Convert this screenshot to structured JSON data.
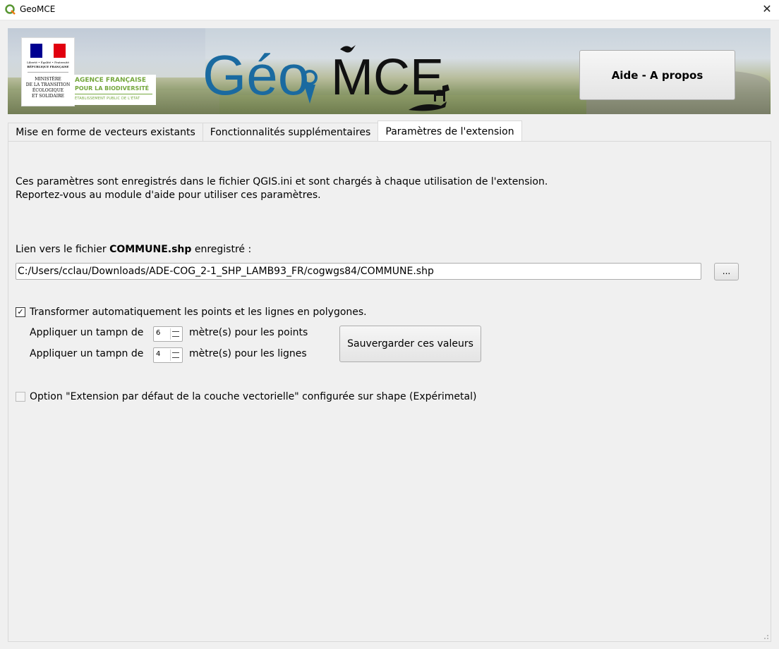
{
  "window": {
    "title": "GeoMCE",
    "close_glyph": "✕"
  },
  "banner": {
    "gov": {
      "motto": "Liberté • Égalité • Fraternité",
      "republic": "RÉPUBLIQUE FRANÇAISE",
      "ministry": [
        "MINISTÈRE",
        "DE LA TRANSITION",
        "ÉCOLOGIQUE",
        "ET SOLIDAIRE"
      ]
    },
    "afb": {
      "line1": "AGENCE FRANÇAISE",
      "line2": "POUR LA BIODIVERSITÉ",
      "line3": "ÉTABLISSEMENT PUBLIC DE L'ÉTAT"
    },
    "logo": {
      "part1": "Géo",
      "part2": "MCE"
    },
    "help_button": "Aide - A propos"
  },
  "tabs": [
    {
      "label": "Mise en forme de vecteurs existants",
      "active": false
    },
    {
      "label": "Fonctionnalités supplémentaires",
      "active": false
    },
    {
      "label": "Paramètres de l'extension",
      "active": true
    }
  ],
  "settings": {
    "description_line1": "Ces paramètres sont enregistrés dans le fichier QGIS.ini et sont chargés à chaque utilisation de l'extension.",
    "description_line2": "Reportez-vous au module d'aide pour utiliser ces paramètres.",
    "file_label_prefix": "Lien vers le fichier",
    "file_label_bold": "COMMUNE.shp",
    "file_label_suffix": "enregistré :",
    "file_path": "C:/Users/cclau/Downloads/ADE-COG_2-1_SHP_LAMB93_FR/cogwgs84/COMMUNE.shp",
    "browse_button": "...",
    "transform_checkbox": {
      "label": "Transformer automatiquement les points et les lignes en polygones.",
      "checked": true
    },
    "buffer_points": {
      "prefix": "Appliquer un tampn de",
      "value": "6",
      "suffix": "mètre(s) pour les points"
    },
    "buffer_lines": {
      "prefix": "Appliquer un tampn de",
      "value": "4",
      "suffix": "mètre(s) pour les lignes"
    },
    "save_button": "Sauvergarder ces valeurs",
    "shape_option": {
      "label": "Option \"Extension par défaut de la couche vectorielle\" configurée sur shape (Expérimetal)",
      "checked": false
    }
  },
  "colors": {
    "qgis_green": "#589632",
    "logo_blue": "#1a6aa0",
    "afb_green": "#74a73c",
    "flag_blue": "#000091",
    "flag_red": "#e1000f"
  }
}
